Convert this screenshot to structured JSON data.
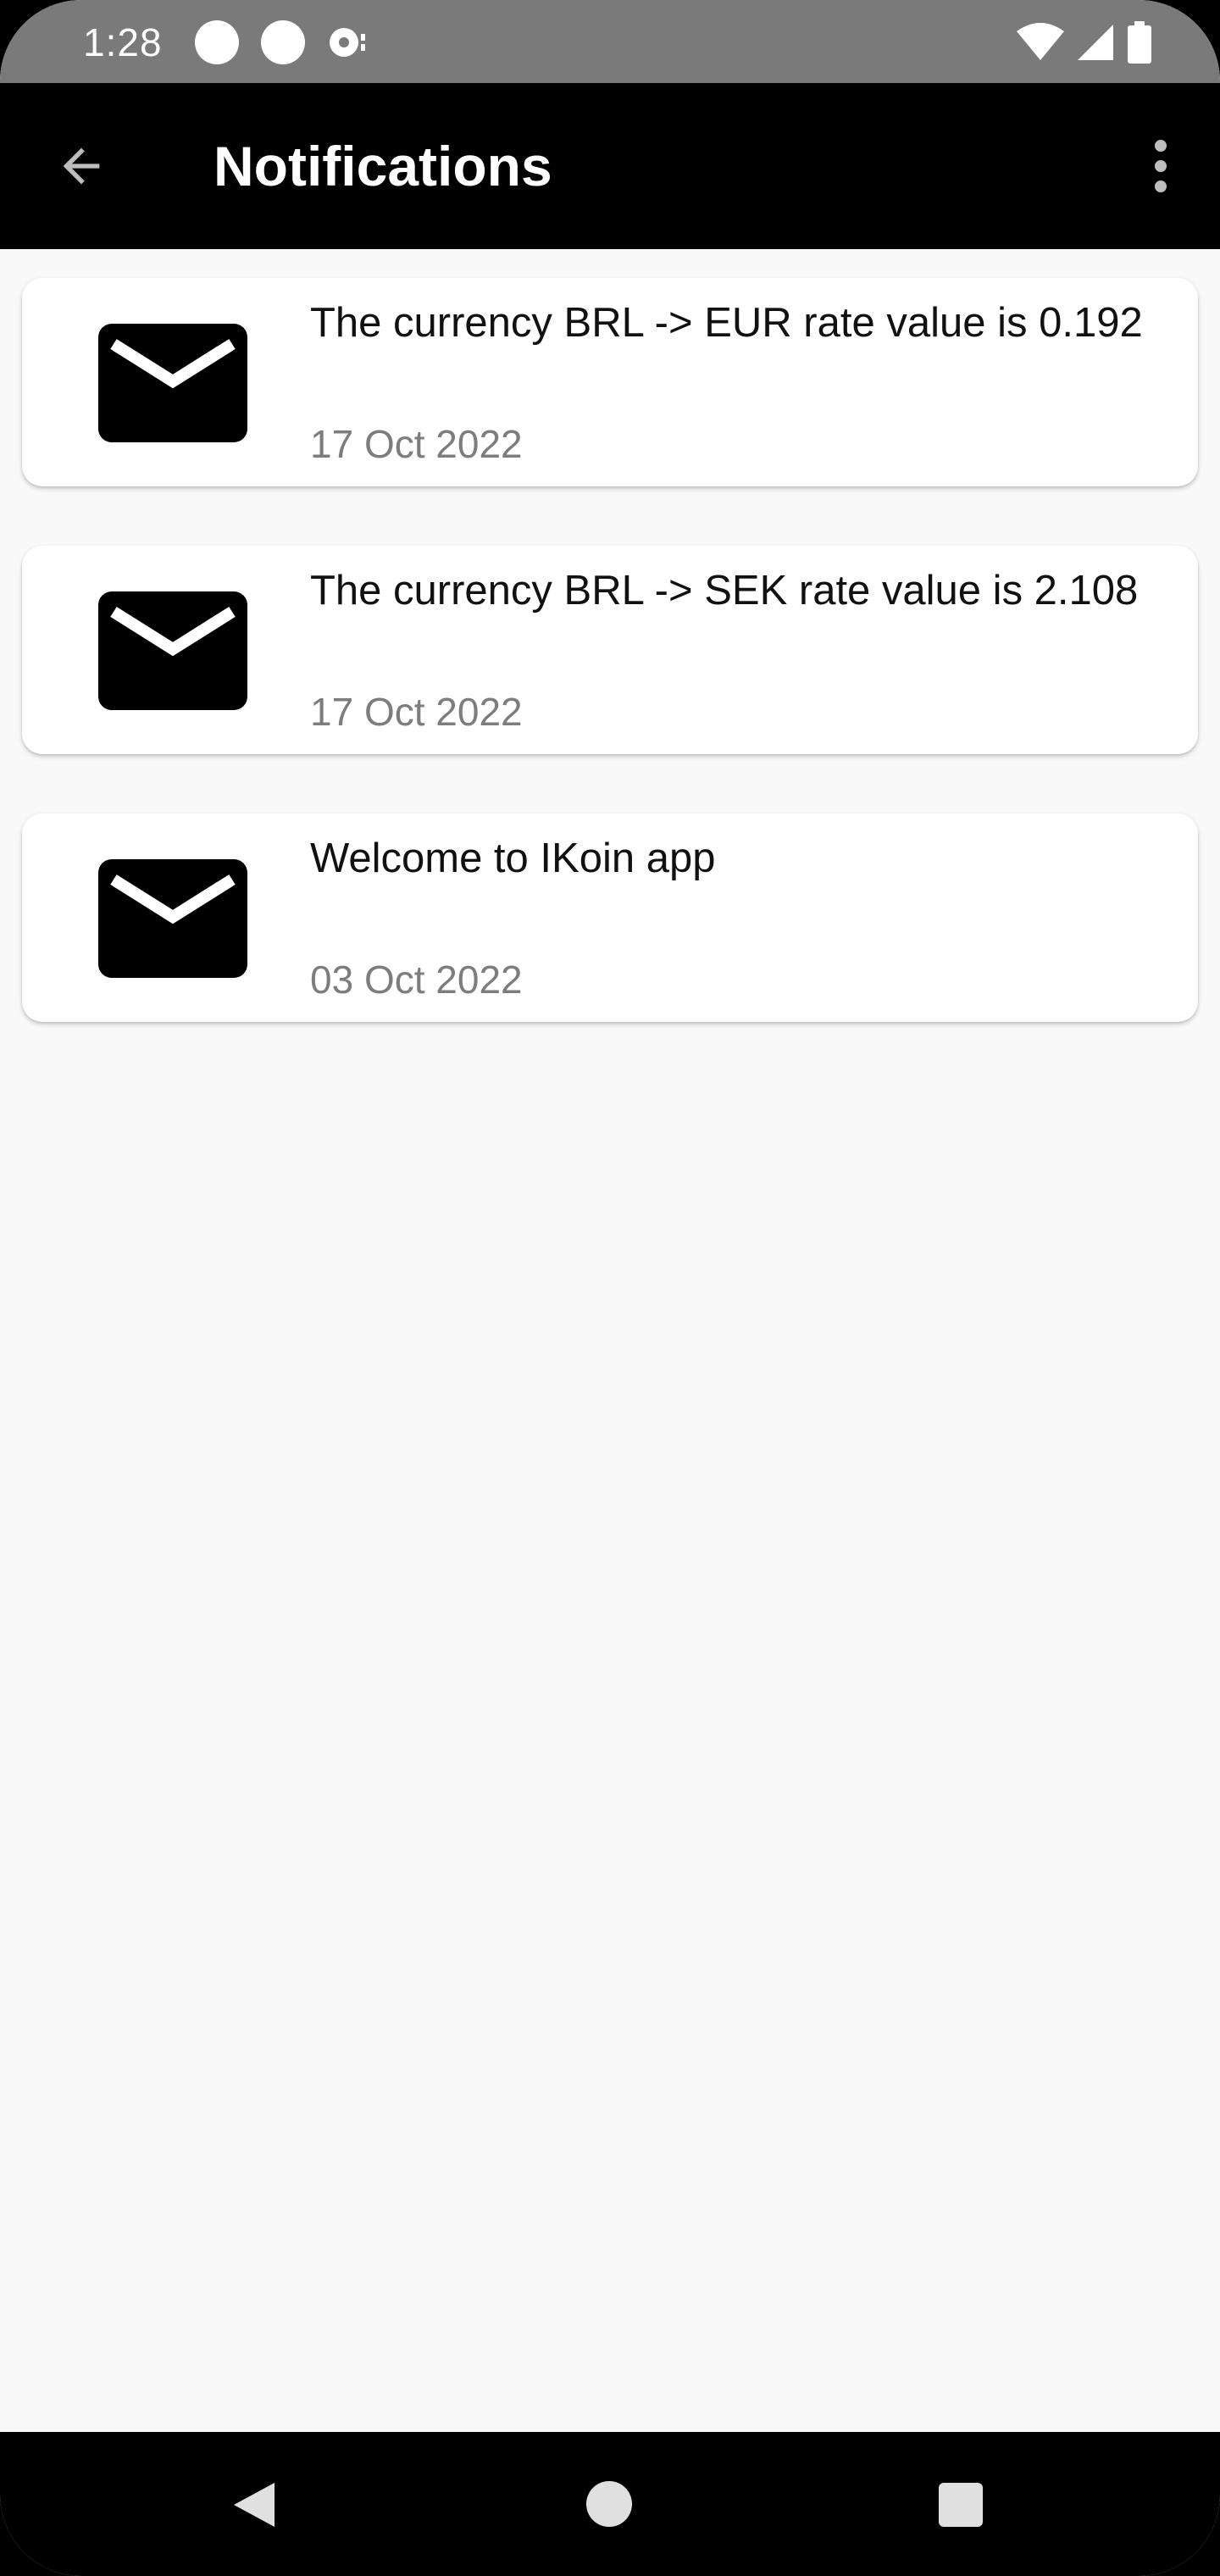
{
  "status_bar": {
    "time": "1:28",
    "icons": [
      "notification-dot-icon",
      "notification-dot-icon",
      "media-disc-icon",
      "wifi-icon",
      "signal-icon",
      "battery-icon"
    ]
  },
  "app_bar": {
    "title": "Notifications",
    "back_icon": "arrow-left-icon",
    "menu_icon": "more-vertical-icon"
  },
  "notifications": [
    {
      "icon": "mail-icon",
      "message": "The currency BRL -> EUR rate value is 0.192",
      "date": "17 Oct 2022"
    },
    {
      "icon": "mail-icon",
      "message": "The currency BRL -> SEK rate value is 2.108",
      "date": "17 Oct 2022"
    },
    {
      "icon": "mail-icon",
      "message": "Welcome to IKoin app",
      "date": "03 Oct 2022"
    }
  ],
  "colors": {
    "app_bar": "#000000",
    "status_bar": "#7a7a7a",
    "background": "#f9f9f9",
    "card": "#ffffff",
    "date_text": "#7d7d7d"
  },
  "nav_bar": {
    "icons": [
      "nav-back-icon",
      "nav-home-icon",
      "nav-recents-icon"
    ]
  }
}
